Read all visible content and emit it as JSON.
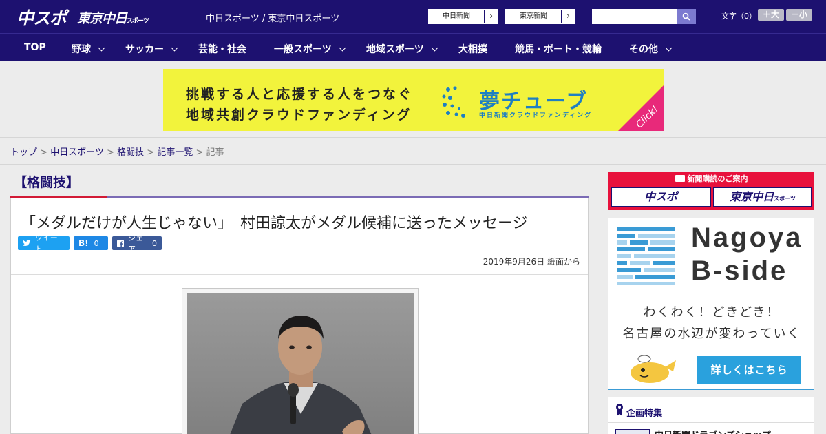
{
  "header": {
    "logo": "中スポ",
    "logo_tokyo": "東京中日",
    "logo_tokyo_sub": "スポーツ",
    "site_links": "中日スポーツ / 東京中日スポーツ",
    "paper_links": [
      "中日新聞",
      "東京新聞"
    ],
    "search_placeholder": "",
    "font_label": "文字（0）",
    "font_bigger": "＋大",
    "font_smaller": "－小"
  },
  "nav": {
    "items": [
      {
        "label": "TOP",
        "dropdown": false
      },
      {
        "label": "野球",
        "dropdown": true
      },
      {
        "label": "サッカー",
        "dropdown": true
      },
      {
        "label": "芸能・社会",
        "dropdown": false
      },
      {
        "label": "一般スポーツ",
        "dropdown": true
      },
      {
        "label": "地域スポーツ",
        "dropdown": true
      },
      {
        "label": "大相撲",
        "dropdown": false
      },
      {
        "label": "競馬・ボート・競輪",
        "dropdown": false
      },
      {
        "label": "その他",
        "dropdown": true
      }
    ]
  },
  "banner": {
    "line1": "挑戦する人と応援する人をつなぐ",
    "line2": "地域共創クラウドファンディング",
    "brand": "夢チューブ",
    "brand_sub": "中日新聞クラウドファンディング",
    "click": "Click!"
  },
  "breadcrumb": {
    "items": [
      "トップ",
      "中日スポーツ",
      "格闘技",
      "記事一覧"
    ],
    "current": "記事",
    "separator": ">"
  },
  "article": {
    "section": "【格闘技】",
    "title": "「メダルだけが人生じゃない」　村田諒太がメダル候補に送ったメッセージ",
    "share": {
      "tweet": "ツイート",
      "hatena": "B!",
      "hatena_count": "0",
      "facebook": "シェア",
      "facebook_count": "0"
    },
    "date": "2019年9月26日 紙面から"
  },
  "sidebar": {
    "subscribe_head": "新聞購読のご案内",
    "subscribe_chunichi": "中スポ",
    "subscribe_tokyo": "東京中日",
    "subscribe_tokyo_sub": "スポーツ",
    "bside_title1": "Nagoya",
    "bside_title2": "B-side",
    "bside_line1": "わくわく！どきどき！",
    "bside_line2": "名古屋の水辺が変わっていく",
    "bside_button": "詳しくはこちら",
    "feature_head": "企画特集",
    "feature_item": "中日新聞ドラゴンズショップ"
  },
  "colors": {
    "brand_navy": "#1d1170",
    "accent_red": "#d21a35",
    "banner_yellow": "#f2f33c",
    "bside_blue": "#2aa1dd"
  }
}
